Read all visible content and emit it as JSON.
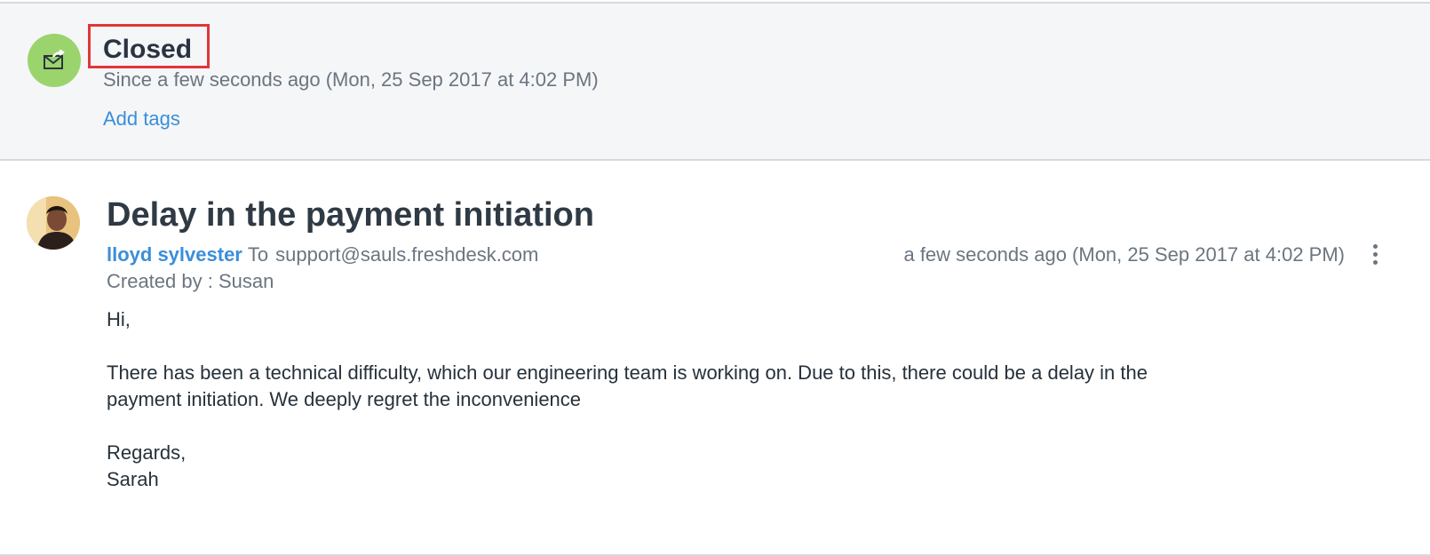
{
  "status": {
    "title": "Closed",
    "since": "Since a few seconds ago (Mon, 25 Sep 2017 at 4:02 PM)",
    "add_tags": "Add tags",
    "icon": "envelope-forward-icon",
    "icon_color": "#9bd46c",
    "highlight_color": "#e0363b"
  },
  "message": {
    "subject": "Delay in the payment initiation",
    "sender": "lloyd sylvester",
    "to_label": "To",
    "recipient": "support@sauls.freshdesk.com",
    "timestamp": "a few seconds ago (Mon, 25 Sep 2017 at 4:02 PM)",
    "created_by": "Created by : Susan",
    "body": {
      "greeting": "Hi,",
      "line1": "There has been a technical difficulty, which our engineering team is working on. Due to this, there could be a delay in the",
      "line2": "payment initiation. We deeply regret the inconvenience",
      "closing": "Regards,",
      "signature": "Sarah"
    },
    "menu_icon": "vertical-dots-icon",
    "avatar_icon": "user-avatar"
  },
  "colors": {
    "link": "#3b8ed8",
    "panel_bg": "#f4f6f8"
  }
}
